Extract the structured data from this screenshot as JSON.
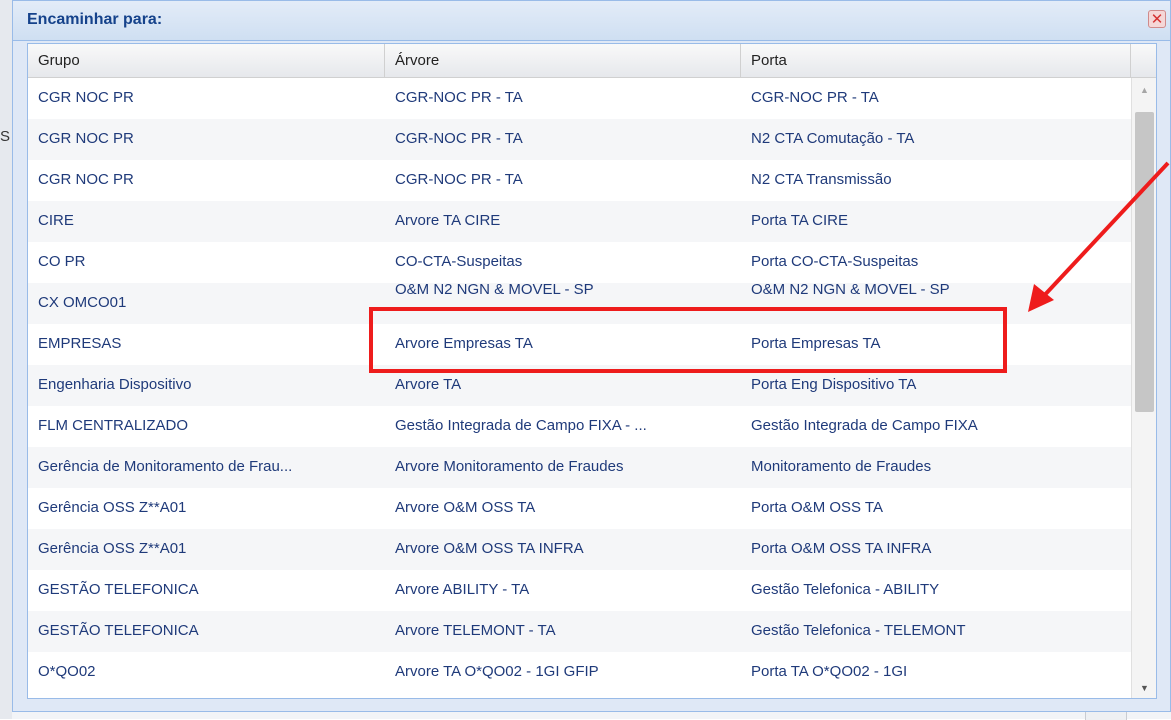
{
  "dialog": {
    "title": "Encaminhar para:",
    "close_icon": "close-icon",
    "close_glyph": "✕"
  },
  "background": {
    "edge_letter": "S"
  },
  "grid": {
    "columns": [
      "Grupo",
      "Árvore",
      "Porta"
    ],
    "rows": [
      [
        "CGR NOC PR",
        "CGR-NOC PR - TA",
        "CGR-NOC PR - TA"
      ],
      [
        "CGR NOC PR",
        "CGR-NOC PR - TA",
        "N2 CTA Comutação - TA"
      ],
      [
        "CGR NOC PR",
        "CGR-NOC PR - TA",
        "N2 CTA Transmissão"
      ],
      [
        "CIRE",
        "Arvore TA CIRE",
        "Porta TA CIRE"
      ],
      [
        "CO PR",
        "CO-CTA-Suspeitas",
        "Porta CO-CTA-Suspeitas"
      ],
      [
        "CX OMCO01",
        "O&M N2 NGN & MOVEL - SP",
        "O&M N2 NGN & MOVEL - SP"
      ],
      [
        "EMPRESAS",
        "Arvore Empresas TA",
        "Porta Empresas TA"
      ],
      [
        "Engenharia Dispositivo",
        "Arvore TA",
        "Porta Eng Dispositivo TA"
      ],
      [
        "FLM CENTRALIZADO",
        "Gestão Integrada de Campo FIXA - ...",
        "Gestão Integrada de Campo FIXA"
      ],
      [
        "Gerência de Monitoramento de Frau...",
        "Arvore Monitoramento de Fraudes",
        "Monitoramento de Fraudes"
      ],
      [
        "Gerência OSS Z**A01",
        "Arvore O&M OSS TA",
        "Porta O&M OSS TA"
      ],
      [
        "Gerência OSS Z**A01",
        "Arvore O&M OSS TA INFRA",
        "Porta O&M OSS TA INFRA"
      ],
      [
        "GESTÃO TELEFONICA",
        "Arvore ABILITY - TA",
        "Gestão Telefonica - ABILITY"
      ],
      [
        "GESTÃO TELEFONICA",
        "Arvore TELEMONT - TA",
        "Gestão Telefonica - TELEMONT"
      ],
      [
        "O*QO02",
        "Arvore TA O*QO02 - 1GI GFIP",
        "Porta TA O*QO02 - 1GI"
      ]
    ]
  },
  "scrollbar": {
    "up_glyph": "▲",
    "down_glyph": "▼"
  },
  "annotation": {
    "highlight_color": "#ee1c1c",
    "highlighted_row": "EMPRESAS"
  }
}
